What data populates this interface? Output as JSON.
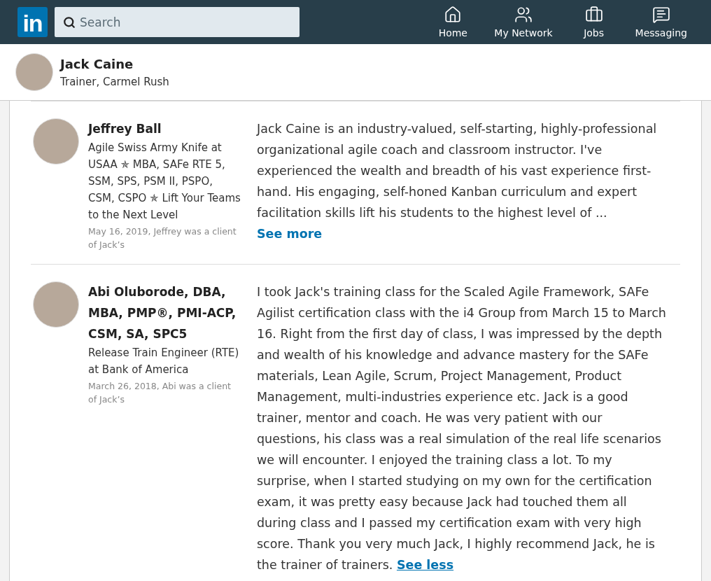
{
  "nav": {
    "logo": "in",
    "search": {
      "placeholder": "Search"
    },
    "items": [
      {
        "kind": "home",
        "label": "Home"
      },
      {
        "kind": "network",
        "label": "My Network"
      },
      {
        "kind": "jobs",
        "label": "Jobs"
      },
      {
        "kind": "messaging",
        "label": "Messaging"
      }
    ]
  },
  "profile": {
    "name": "Jack Caine",
    "headline": "Trainer, Carmel Rush"
  },
  "recommendations": [
    {
      "name": "Jeffrey Ball",
      "headline": "Agile Swiss Army Knife at USAA ✯ MBA, SAFe RTE 5, SSM, SPS, PSM II, PSPO, CSM, CSPO ✯ Lift Your Teams to the Next Level",
      "meta": "May 16, 2019, Jeffrey was a client of Jack’s",
      "text": "Jack Caine is an industry-valued, self-starting, highly-professional organizational agile coach and classroom instructor. I've experienced the wealth and breadth of his vast experience first-hand. His engaging, self-honed Kanban curriculum and expert facilitation skills lift his students to the highest level of ...",
      "toggle": "See more",
      "expanded": false
    },
    {
      "name": "Abi Oluborode, DBA, MBA, PMP®, PMI-ACP, CSM, SA, SPC5",
      "headline": "Release Train Engineer (RTE) at Bank of America",
      "meta": "March 26, 2018, Abi was a client of Jack’s",
      "text": "I took Jack's training class for the Scaled Agile Framework, SAFe Agilist certification class with the i4 Group from March 15 to March 16. Right from the first day of class, I was impressed by the depth and wealth of his knowledge and advance mastery for the SAFe materials, Lean Agile, Scrum, Project Management, Product Management, multi-industries experience etc. Jack is a good trainer, mentor and coach. He was very patient with our questions, his class was a real simulation of the real life scenarios we will encounter. I enjoyed the training class a lot. To my surprise, when I started studying on my own for the certification exam, it was pretty easy because Jack had touched them all during class and I passed my certification exam with very high score. Thank you very much Jack, I highly recommend Jack, he is the trainer of trainers.",
      "toggle": "See less",
      "expanded": true
    }
  ]
}
